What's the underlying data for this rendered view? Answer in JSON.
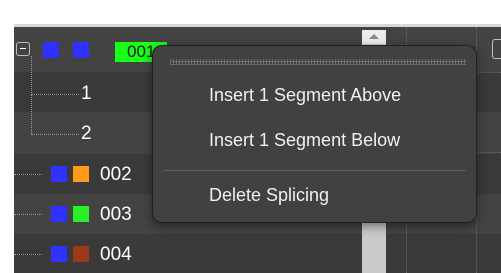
{
  "tree": {
    "rows": [
      {
        "id": "row-001",
        "label": "001",
        "swatch_a": "#3131ff",
        "swatch_b": "#3131ff",
        "selected": true
      },
      {
        "id": "row-1",
        "label": "1"
      },
      {
        "id": "row-2",
        "label": "2"
      },
      {
        "id": "row-002",
        "label": "002",
        "swatch_a": "#3131ff",
        "swatch_b": "#ff9a1a"
      },
      {
        "id": "row-003",
        "label": "003",
        "swatch_a": "#3131ff",
        "swatch_b": "#29f029"
      },
      {
        "id": "row-004",
        "label": "004",
        "swatch_a": "#3131ff",
        "swatch_b": "#9a3a1a"
      }
    ]
  },
  "context_menu": {
    "items": [
      {
        "label": "Insert 1 Segment Above"
      },
      {
        "label": "Insert 1 Segment Below"
      },
      {
        "label": "Delete Splicing"
      }
    ]
  },
  "colors": {
    "panel_bg": "#434343",
    "selected_chip": "#19ff19",
    "menu_bg": "#414141"
  }
}
